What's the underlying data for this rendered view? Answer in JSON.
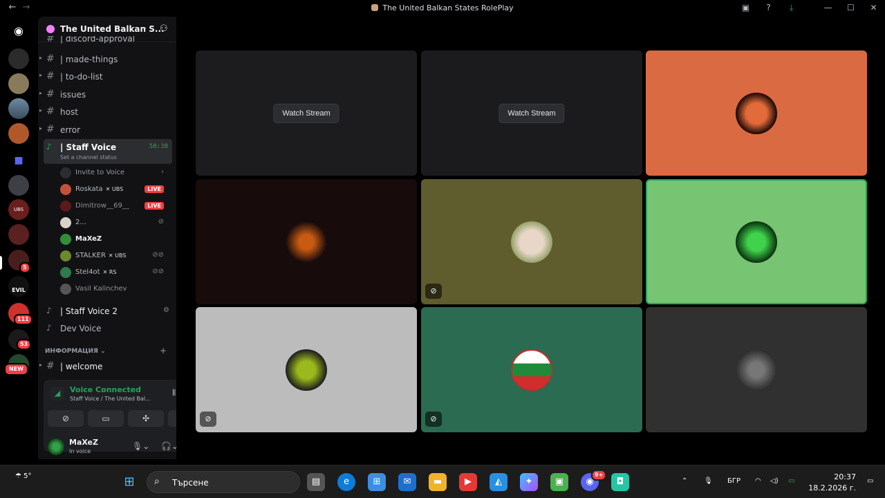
{
  "window": {
    "title": "The United Balkan States RolePlay"
  },
  "guild": {
    "name": "The United Balkan S..."
  },
  "channels": {
    "discord_approval": "| discord-approval",
    "made_things": "| made-things",
    "todo": "| to-do-list",
    "issues": "issues",
    "host": "host",
    "error": "error",
    "staff_voice": "| Staff Voice",
    "staff_voice_timer": "58:38",
    "staff_voice_status": "Set a channel status",
    "invite": "Invite to Voice",
    "staff_voice2": "| Staff Voice 2",
    "dev_voice": "Dev Voice",
    "category": "ИНФОРМАЦИЯ",
    "welcome": "| welcome"
  },
  "members": [
    {
      "name": "Roskata",
      "tag": "UBS",
      "live": "LIVE",
      "color": "#c2533b"
    },
    {
      "name": "Dimitrow__69__",
      "tag": "",
      "live": "LIVE",
      "color": "#5a1a1a"
    },
    {
      "name": "2...",
      "tag": "",
      "live": "",
      "color": "#d8d2c8"
    },
    {
      "name": "MaXeZ",
      "tag": "",
      "live": "",
      "color": "#2f8f3a"
    },
    {
      "name": "STALKER",
      "tag": "UBS",
      "live": "",
      "color": "#6b8a2a"
    },
    {
      "name": "Stel4ot",
      "tag": "RS",
      "live": "",
      "color": "#2c7a4d"
    },
    {
      "name": "Vasil Kalinchev",
      "tag": "",
      "live": "",
      "color": "#555555"
    }
  ],
  "server_badges": {
    "b1": "5",
    "b2": "111",
    "b3": "53",
    "new": "NEW",
    "evil": "EVIL",
    "ubs": "UBS"
  },
  "voice": {
    "status": "Voice Connected",
    "sub": "Staff Voice / The United Bal..."
  },
  "user": {
    "name": "MaXeZ",
    "status": "In voice"
  },
  "tiles": [
    {
      "kind": "stream",
      "label": "Watch Stream",
      "bg": "#1c1c1e"
    },
    {
      "kind": "stream",
      "label": "Watch Stream",
      "bg": "#1b1b1d"
    },
    {
      "kind": "avatar",
      "bg": "#d96a42"
    },
    {
      "kind": "avatar",
      "bg": "#170b0b"
    },
    {
      "kind": "avatar",
      "bg": "#5f5c2e"
    },
    {
      "kind": "avatar",
      "bg": "#77c472"
    },
    {
      "kind": "avatar",
      "bg": "#bcbcbc"
    },
    {
      "kind": "avatar",
      "bg": "#2a6b51"
    },
    {
      "kind": "avatar",
      "bg": "#303030"
    }
  ],
  "taskbar": {
    "weather": "5°",
    "search": "Търсене",
    "lang": "БГР",
    "time": "20:37",
    "date": "18.2.2026 г.",
    "discord_badge": "9+"
  },
  "colors": {
    "accent": "#23a55a",
    "live": "#f23f43"
  }
}
